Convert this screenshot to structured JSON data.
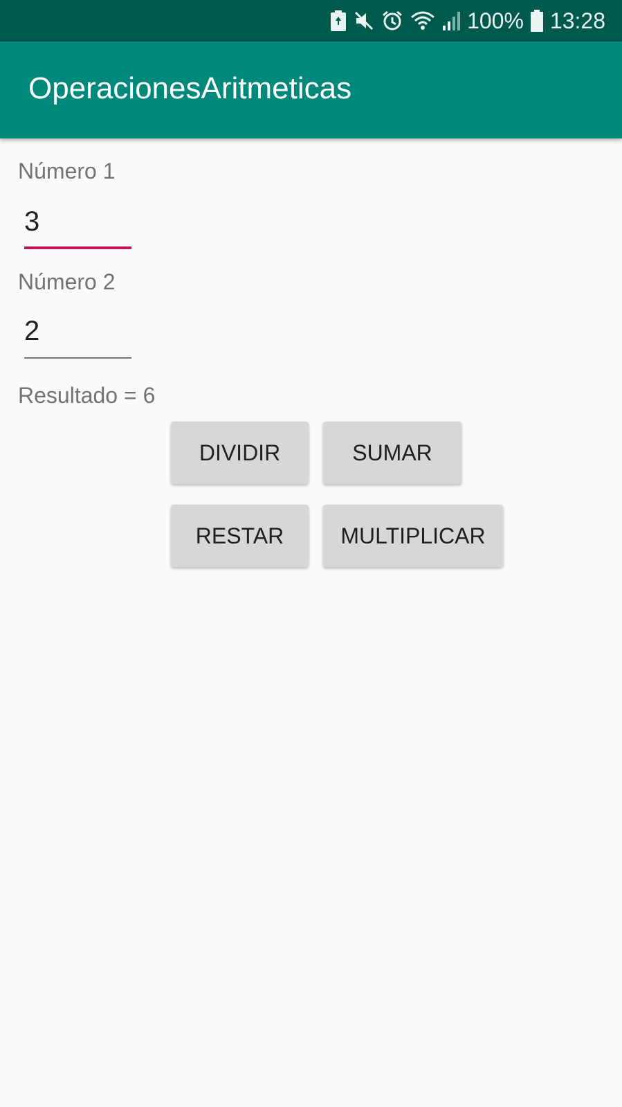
{
  "status_bar": {
    "icons": [
      "battery-saver-icon",
      "mute-icon",
      "alarm-icon",
      "wifi-icon",
      "signal-icon",
      "battery-icon"
    ],
    "battery": "100%",
    "time": "13:28"
  },
  "app_bar": {
    "title": "OperacionesAritmeticas",
    "color": "#00897b",
    "status_color": "#00594d"
  },
  "form": {
    "numero1": {
      "label": "Número 1",
      "value": "3"
    },
    "numero2": {
      "label": "Número 2",
      "value": "2"
    },
    "resultado": "Resultado = 6",
    "accent_color": "#c2185b"
  },
  "buttons": {
    "dividir": "DIVIDIR",
    "sumar": "SUMAR",
    "restar": "RESTAR",
    "multiplicar": "MULTIPLICAR"
  }
}
